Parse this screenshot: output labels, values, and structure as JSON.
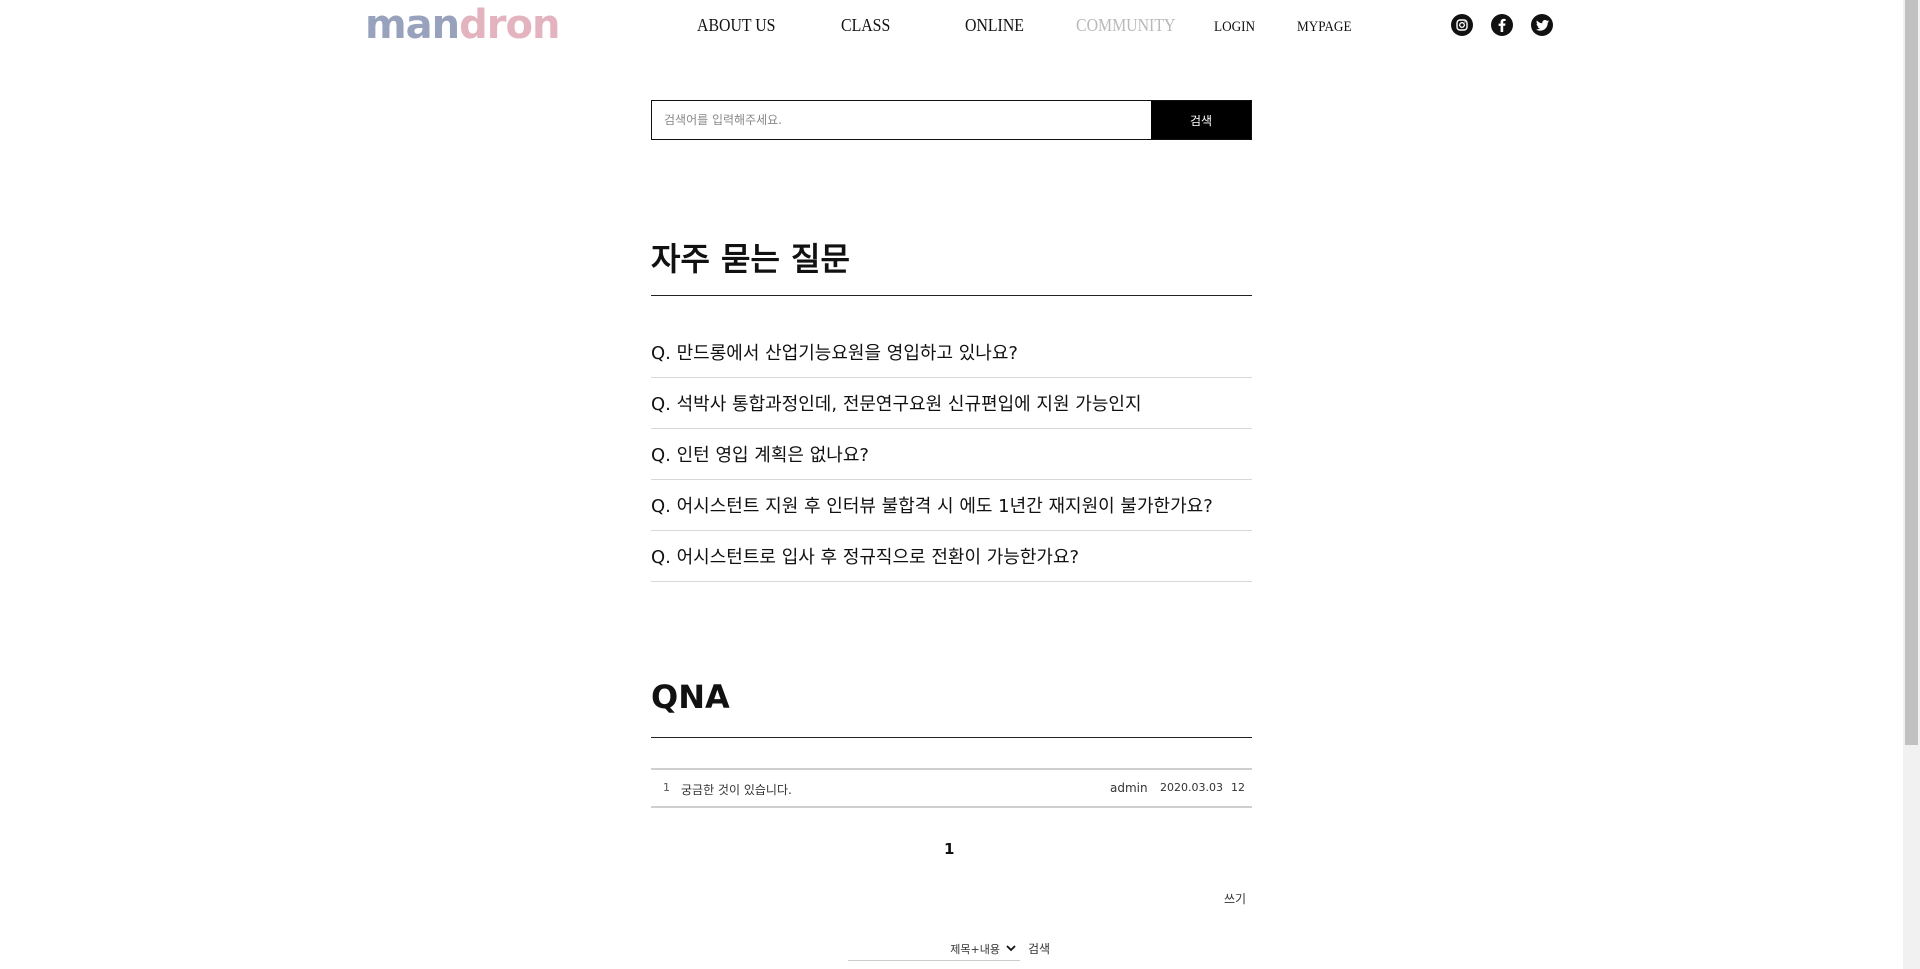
{
  "header": {
    "logo_part1": "man",
    "logo_part2": "dron",
    "nav": {
      "about": "ABOUT US",
      "class": "CLASS",
      "online": "ONLINE",
      "community": "COMMUNITY",
      "login": "LOGIN",
      "mypage": "MYPAGE"
    },
    "social_icons": [
      "instagram-icon",
      "facebook-icon",
      "twitter-icon"
    ]
  },
  "search": {
    "placeholder": "검색어를 입력해주세요.",
    "value": "",
    "button_label": "검색"
  },
  "faq": {
    "title": "자주 묻는 질문",
    "items": [
      "Q. 만드롱에서 산업기능요원을 영입하고 있나요?",
      "Q. 석박사 통합과정인데, 전문연구요원 신규편입에 지원 가능인지",
      "Q. 인턴 영입 계획은 없나요?",
      "Q. 어시스턴트 지원 후 인터뷰 불합격 시 에도 1년간 재지원이 불가한가요?",
      "Q. 어시스턴트로 입사 후 정규직으로 전환이 가능한가요?"
    ]
  },
  "qna": {
    "title": "QNA",
    "rows": [
      {
        "num": "1",
        "subject": "궁금한 것이 있습니다.",
        "author": "admin",
        "date": "2020.03.03",
        "views": "12"
      }
    ],
    "page": "1",
    "write_label": "쓰기",
    "search_field_option": "제목+내용",
    "search_label": "검색"
  },
  "colors": {
    "logo_blue": "#98a2bd",
    "logo_pink": "#e3b4bf",
    "nav_muted": "#b9b9b9",
    "button_bg": "#000000"
  }
}
